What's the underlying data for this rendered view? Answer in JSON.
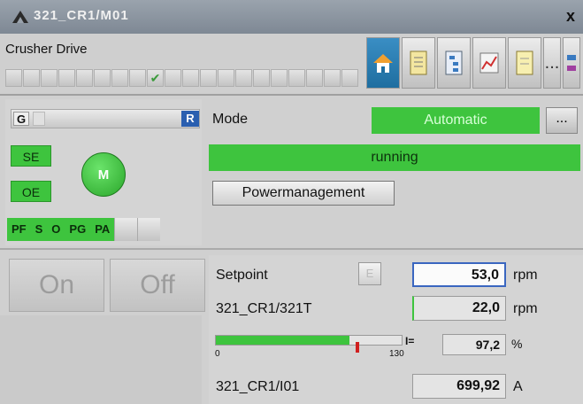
{
  "window": {
    "title": "321_CR1/M01",
    "close": "x"
  },
  "header": {
    "device_name": "Crusher Drive",
    "check_mark": "✔",
    "toolbar_more": "...",
    "icons": [
      "faceplate-home-icon",
      "document-icon",
      "tree-icon",
      "chart-icon",
      "notes-icon",
      "more-icon",
      "extra-icon"
    ]
  },
  "left": {
    "g_label": "G",
    "r_label": "R",
    "se_label": "SE",
    "oe_label": "OE",
    "motor_label": "M",
    "pf_items": [
      "PF",
      "S",
      "O",
      "PG",
      "PA"
    ]
  },
  "mode": {
    "label": "Mode",
    "value": "Automatic",
    "more": "...",
    "state": "running",
    "powermanagement": "Powermanagement"
  },
  "buttons": {
    "on": "On",
    "off": "Off"
  },
  "values": {
    "setpoint_label": "Setpoint",
    "setpoint_value": "53,0",
    "setpoint_unit": "rpm",
    "e_label": "E",
    "tag1_label": "321_CR1/321T",
    "tag1_value": "22,0",
    "tag1_unit": "rpm",
    "bar_min": "0",
    "bar_max": "130",
    "bar_fraction": 0.72,
    "i_label": "I=",
    "current_pct": "97,2",
    "current_unit": "%",
    "tag2_label": "321_CR1/I01",
    "tag2_value": "699,92",
    "tag2_unit": "A"
  },
  "colors": {
    "green": "#3ec43e",
    "blue": "#2a5fb0",
    "marker": "#d02020"
  }
}
